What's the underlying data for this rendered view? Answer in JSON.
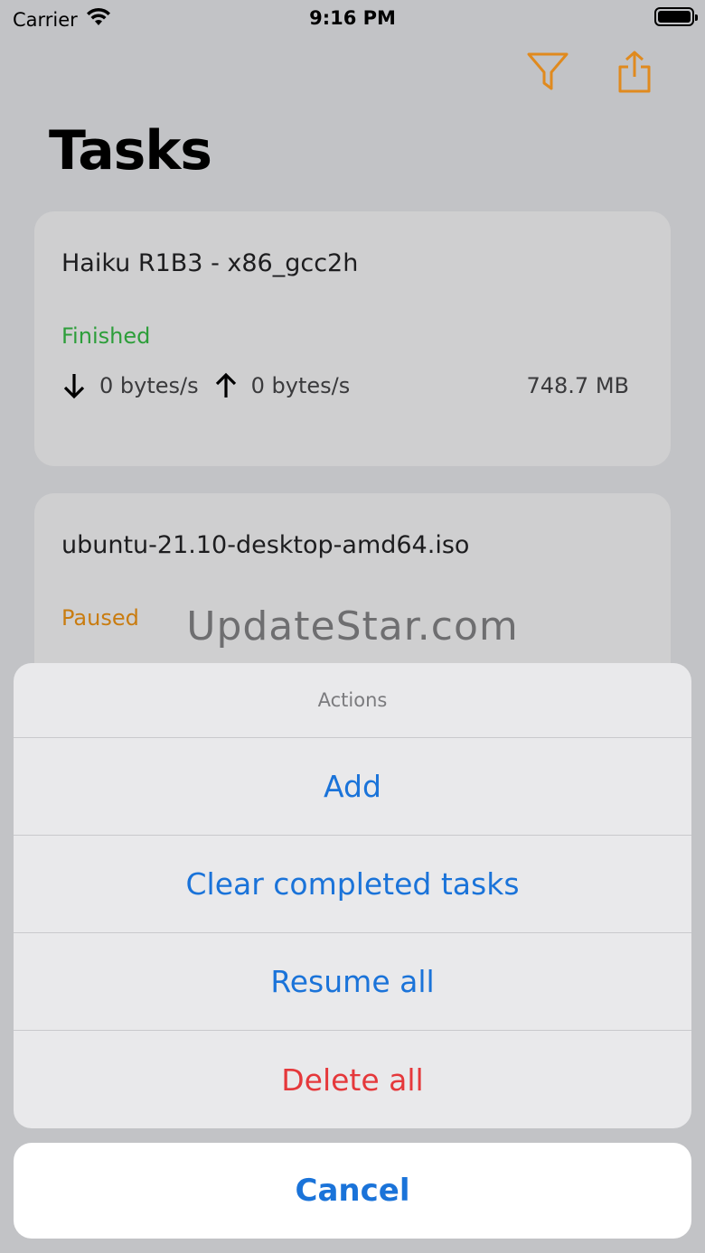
{
  "status_bar": {
    "carrier": "Carrier",
    "time": "9:16 PM",
    "icons": [
      "wifi-icon",
      "battery-icon"
    ]
  },
  "nav": {
    "icons": [
      "filter-icon",
      "share-icon"
    ],
    "accent_color": "#e08a1e"
  },
  "page": {
    "title": "Tasks"
  },
  "tasks": [
    {
      "name": "Haiku R1B3 - x86_gcc2h",
      "status": "Finished",
      "status_color": "#2d9e3a",
      "download_speed": "0 bytes/s",
      "upload_speed": "0 bytes/s",
      "size": "748.7 MB"
    },
    {
      "name": "ubuntu-21.10-desktop-amd64.iso",
      "status": "Paused",
      "status_color": "#c97c10"
    }
  ],
  "watermark": "UpdateStar.com",
  "action_sheet": {
    "title": "Actions",
    "items": [
      {
        "label": "Add",
        "style": "default"
      },
      {
        "label": "Clear completed tasks",
        "style": "default"
      },
      {
        "label": "Resume all",
        "style": "default"
      },
      {
        "label": "Delete all",
        "style": "destructive"
      }
    ],
    "cancel_label": "Cancel",
    "tint_color": "#1a73d9",
    "destructive_color": "#e5383b"
  }
}
